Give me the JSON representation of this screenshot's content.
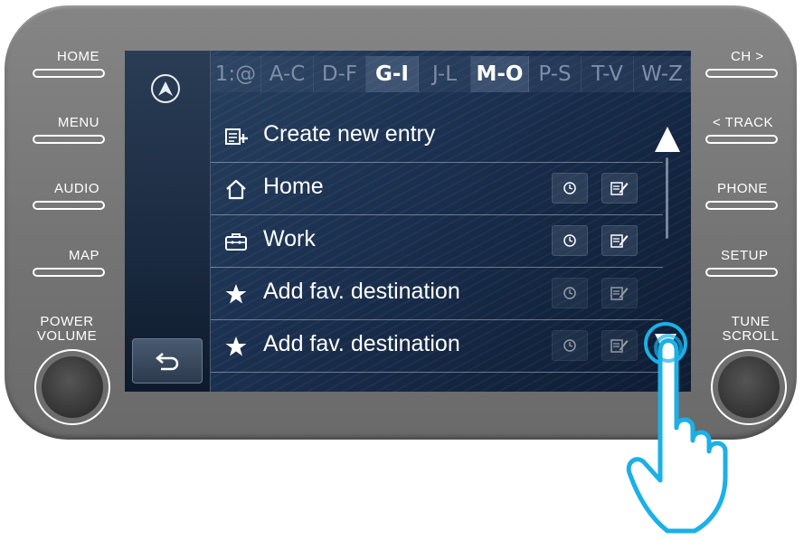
{
  "hardware": {
    "left_buttons": [
      "HOME",
      "MENU",
      "AUDIO",
      "MAP"
    ],
    "right_buttons": [
      "CH >",
      "< TRACK",
      "PHONE",
      "SETUP"
    ],
    "left_knob_label": [
      "POWER",
      "VOLUME"
    ],
    "right_knob_label": [
      "TUNE",
      "SCROLL"
    ]
  },
  "tabs": [
    {
      "label": "1:@",
      "active": false
    },
    {
      "label": "A-C",
      "active": false
    },
    {
      "label": "D-F",
      "active": false
    },
    {
      "label": "G-I",
      "active": true
    },
    {
      "label": "J-L",
      "active": false
    },
    {
      "label": "M-O",
      "active": true
    },
    {
      "label": "P-S",
      "active": false
    },
    {
      "label": "T-V",
      "active": false
    },
    {
      "label": "W-Z",
      "active": false
    }
  ],
  "list": {
    "create": {
      "label": "Create new entry",
      "icon": "add-entry-icon"
    },
    "items": [
      {
        "label": "Home",
        "icon": "house-icon",
        "dim": false
      },
      {
        "label": "Work",
        "icon": "briefcase-icon",
        "dim": false
      },
      {
        "label": "Add fav. destination",
        "icon": "star-icon",
        "dim": true
      },
      {
        "label": "Add fav. destination",
        "icon": "star-icon",
        "dim": true
      }
    ]
  },
  "colors": {
    "accent_highlight": "#1ab0e8",
    "bezel": "#787878",
    "screen_bg": "#1b3050"
  }
}
